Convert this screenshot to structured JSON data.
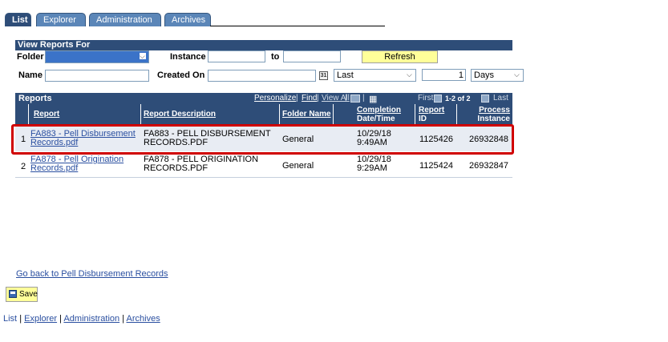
{
  "tabs": [
    "List",
    "Explorer",
    "Administration",
    "Archives"
  ],
  "filters": {
    "section_title": "View Reports For",
    "folder_label": "Folder",
    "folder_value": "",
    "instance_label": "Instance",
    "instance_from": "",
    "to_label": "to",
    "instance_to": "",
    "refresh_label": "Refresh",
    "name_label": "Name",
    "name_value": "",
    "created_on_label": "Created On",
    "created_on_value": "",
    "period_select": "Last",
    "period_count": "1",
    "period_unit": "Days"
  },
  "grid": {
    "title": "Reports",
    "personalize": "Personalize",
    "find": "Find",
    "view_all": "View All",
    "first": "First",
    "range": "1-2 of 2",
    "last": "Last",
    "columns": {
      "report": "Report",
      "description": "Report Description",
      "folder": "Folder Name",
      "completion_1": "Completion",
      "completion_2": "Date/Time",
      "report_id_1": "Report",
      "report_id_2": "ID",
      "process_1": "Process",
      "process_2": "Instance"
    },
    "rows": [
      {
        "num": "1",
        "report_1": "FA883 - Pell Disbursement",
        "report_2": "Records.pdf",
        "desc_1": "FA883 - PELL DISBURSEMENT",
        "desc_2": "RECORDS.PDF",
        "folder": "General",
        "date": "10/29/18",
        "time": "9:49AM",
        "report_id": "1125426",
        "process_instance": "26932848"
      },
      {
        "num": "2",
        "report_1": "FA878 - Pell Origination",
        "report_2": "Records.pdf",
        "desc_1": "FA878 - PELL ORIGINATION",
        "desc_2": "RECORDS.PDF",
        "folder": "General",
        "date": "10/29/18",
        "time": "9:29AM",
        "report_id": "1125424",
        "process_instance": "26932847"
      }
    ]
  },
  "go_back": "Go back to Pell Disbursement Records",
  "save_label": "Save",
  "footer_links": [
    "List",
    "Explorer",
    "Administration",
    "Archives"
  ],
  "colors": {
    "header_blue": "#2e4d78",
    "tab_blue": "#5b86b8",
    "button_yellow": "#ffff99",
    "row_even": "#e8ecf3",
    "highlight_red": "#d00000",
    "link": "#2a4fa0"
  }
}
